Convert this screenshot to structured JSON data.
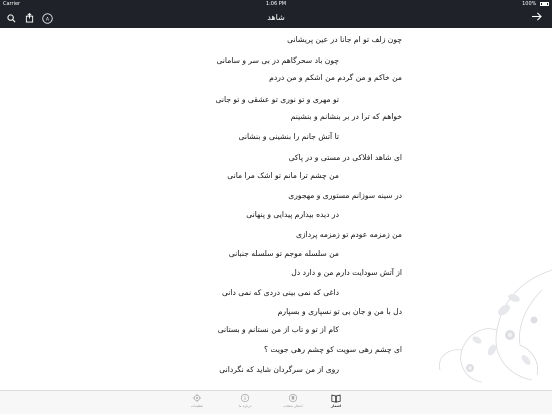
{
  "status_bar": {
    "carrier": "Carrier",
    "time": "1:06 PM",
    "battery": "100%"
  },
  "navbar": {
    "title": "شاهد"
  },
  "poem": {
    "lines": [
      "چون زلف تو ام جانا در عین پریشانی",
      "چون باد سحرگاهم در بی سر و سامانی",
      "من خاکم و من گردم من اشکم و من دردم",
      "تو مهری و تو نوری تو عشقی و تو جانی",
      "خواهم که ترا در بر بنشانم و بنشینم",
      "تا آتش جانم را بنشینی و بنشانی",
      "ای شاهد افلاکی در مستی و در پاکی",
      "من چشم ترا مانم تو اشک مرا مانی",
      "در سینه سوزانم مستوری و مهجوری",
      "در دیده بیدارم پیدایی و پنهانی",
      "من زمزمه عودم تو زمزمه پردازی",
      "من سلسله موجم تو سلسله جنبانی",
      "از آتش سودایت دارم من و دارد دل",
      "داغی که نمی بینی دردی که نمی دانی",
      "دل با من و جان بی تو نسپاری و بسپارم",
      "کام از تو و تاب از من نستانم و بستانی",
      "ای چشم رهی سویت کو چشم رهی جویت ؟",
      "روی از من سرگردان شاید که نگردانی"
    ]
  },
  "tabbar": {
    "tabs": [
      {
        "label": "اشعار",
        "icon": "book-icon",
        "active": true
      },
      {
        "label": "اشعار منتخب",
        "icon": "bookmark-icon",
        "active": false
      },
      {
        "label": "درباره ما",
        "icon": "info-icon",
        "active": false
      },
      {
        "label": "تنظیمات",
        "icon": "settings-icon",
        "active": false
      }
    ]
  },
  "colors": {
    "bar": "#1f2228",
    "text": "#111111",
    "tab_inactive": "#9a9a9a"
  }
}
